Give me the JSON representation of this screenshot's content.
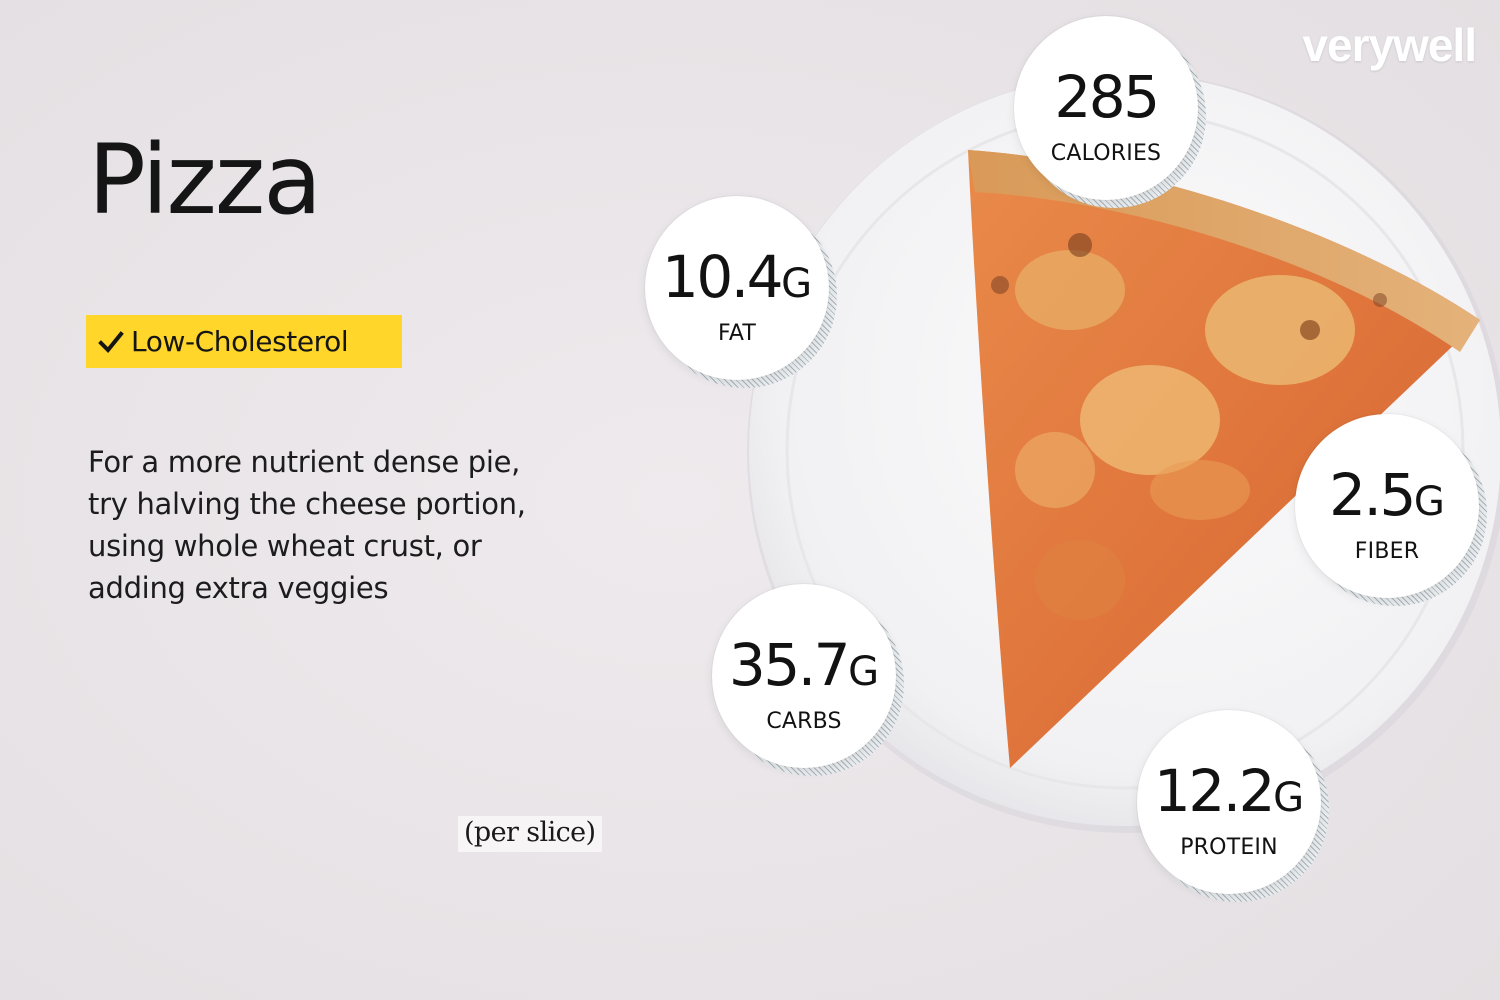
{
  "brand": "verywell",
  "title": "Pizza",
  "badge": {
    "icon": "check-icon",
    "label": "Low-Cholesterol",
    "color": "#ffd629"
  },
  "description": [
    "For a more nutrient dense pie,",
    "try halving the cheese portion,",
    "using whole wheat crust, or",
    "adding extra veggies"
  ],
  "serving": "(per slice)",
  "nutrition": {
    "calories": {
      "value": "285",
      "unit": "",
      "label": "CALORIES"
    },
    "fat": {
      "value": "10.4",
      "unit": "G",
      "label": "FAT"
    },
    "fiber": {
      "value": "2.5",
      "unit": "G",
      "label": "FIBER"
    },
    "carbs": {
      "value": "35.7",
      "unit": "G",
      "label": "CARBS"
    },
    "protein": {
      "value": "12.2",
      "unit": "G",
      "label": "PROTEIN"
    }
  }
}
